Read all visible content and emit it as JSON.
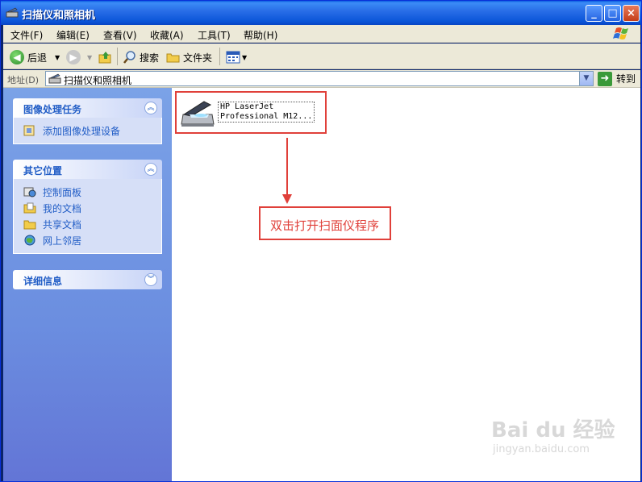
{
  "window": {
    "title": "扫描仪和照相机",
    "buttons": {
      "minimize": "_",
      "maximize": "□",
      "close": "×"
    }
  },
  "menu": {
    "items": [
      "文件(F)",
      "编辑(E)",
      "查看(V)",
      "收藏(A)",
      "工具(T)",
      "帮助(H)"
    ]
  },
  "toolbar": {
    "back_label": "后退",
    "search_label": "搜索",
    "folders_label": "文件夹"
  },
  "address": {
    "label": "地址(D)",
    "value": "扫描仪和照相机",
    "go_label": "转到"
  },
  "sidebar": {
    "panels": [
      {
        "title": "图像处理任务",
        "items": [
          "添加图像处理设备"
        ]
      },
      {
        "title": "其它位置",
        "items": [
          "控制面板",
          "我的文档",
          "共享文档",
          "网上邻居"
        ]
      },
      {
        "title": "详细信息",
        "items": []
      }
    ]
  },
  "content": {
    "device_label_line1": "HP LaserJet",
    "device_label_line2": "Professional M12...",
    "annotation_text": "双击打开扫面仪程序"
  },
  "watermark": {
    "main": "Bai du 经验",
    "sub": "jingyan.baidu.com"
  },
  "colors": {
    "title_bar": "#2a6fe8",
    "sidebar": "#6b8ee0",
    "annotation": "#e0403a",
    "link": "#215dc6"
  }
}
